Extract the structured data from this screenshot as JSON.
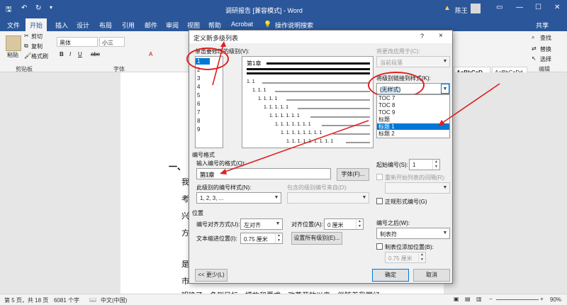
{
  "titlebar": {
    "title": "调研报告 [兼容模式] - Word",
    "user": "陈王",
    "qat_icons": [
      "save-icon",
      "undo-icon",
      "redo-icon"
    ]
  },
  "ribbon_tabs": [
    "文件",
    "开始",
    "插入",
    "设计",
    "布局",
    "引用",
    "邮件",
    "审阅",
    "视图",
    "帮助",
    "Acrobat",
    "操作说明搜索"
  ],
  "active_tab": "开始",
  "share_label": "共享",
  "ribbon": {
    "paste_label": "粘贴",
    "cut_label": "剪切",
    "copy_label": "复制",
    "format_painter_label": "格式刷",
    "clipboard_group": "剪贴板",
    "font_name": "黑体",
    "font_size": "小三",
    "font_group": "字体",
    "styles": [
      "AaBbCcD",
      "AaBbCcDd"
    ],
    "style_names": [
      "",
      "正文"
    ],
    "find_label": "查找",
    "replace_label": "替换",
    "select_label": "选择",
    "edit_group": "编辑"
  },
  "document": {
    "heading_start": "一、",
    "chars": [
      "我",
      "考",
      "兴",
      "方",
      "是",
      "市"
    ],
    "bottom_line": "明确了，多到目标，措施和要求，改革开放以来，伴随着我国经"
  },
  "statusbar": {
    "page": "第 5 页，共 18 页",
    "words": "6081 个字",
    "lang": "中文(中国)",
    "zoom": "90%"
  },
  "dialog": {
    "title": "定义新多级列表",
    "help": "?",
    "close": "×",
    "level_label": "单击要修改的级别(V):",
    "levels": [
      "1",
      "2",
      "3",
      "4",
      "5",
      "6",
      "7",
      "8",
      "9"
    ],
    "selected_level": "1",
    "preview_first": "第1章",
    "preview_levels": [
      "1. 1",
      "1. 1. 1",
      "1. 1. 1. 1",
      "1. 1. 1. 1. 1",
      "1. 1. 1. 1. 1. 1",
      "1. 1. 1. 1. 1. 1. 1",
      "1. 1. 1. 1. 1. 1. 1. 1",
      "1. 1. 1. 1. 1. 1. 1. 1. 1"
    ],
    "apply_to_label": "将更改应用于(C):",
    "apply_to_value": "当前段落",
    "link_style_label": "将级别链接到样式(K):",
    "link_style_value": "(无样式)",
    "link_style_options": [
      "TOC 7",
      "TOC 8",
      "TOC 9",
      "标题",
      "标题 1",
      "标题 2"
    ],
    "link_style_selected": "标题 1",
    "number_format_section": "编号格式",
    "enter_format_label": "输入编号的格式(O):",
    "enter_format_value": "第1章",
    "font_button": "字体(F)...",
    "start_at_label": "起始编号(S):",
    "start_at_value": "1",
    "restart_label": "重新开始列表的间隔(R):",
    "number_style_label": "此级别的编号样式(N):",
    "number_style_value": "1, 2, 3, ...",
    "include_from_label": "包含的级别编号来自(D):",
    "legal_label": "正规形式编号(G)",
    "position_section": "位置",
    "alignment_label": "编号对齐方式(U):",
    "alignment_value": "左对齐",
    "aligned_at_label": "对齐位置(A):",
    "aligned_at_value": "0 厘米",
    "indent_label": "文本缩进位置(I):",
    "indent_value": "0.75 厘米",
    "set_all_button": "设置所有级别(E)...",
    "follow_label": "编号之后(W):",
    "follow_value": "制表符",
    "tab_stop_label": "制表位添加位置(B):",
    "tab_stop_value": "0.75 厘米",
    "less_button": "<< 更少(L)",
    "ok_button": "确定",
    "cancel_button": "取消"
  },
  "colors": {
    "word_blue": "#2b579a",
    "annotation_red": "#e02020",
    "selection_blue": "#0078d7"
  }
}
